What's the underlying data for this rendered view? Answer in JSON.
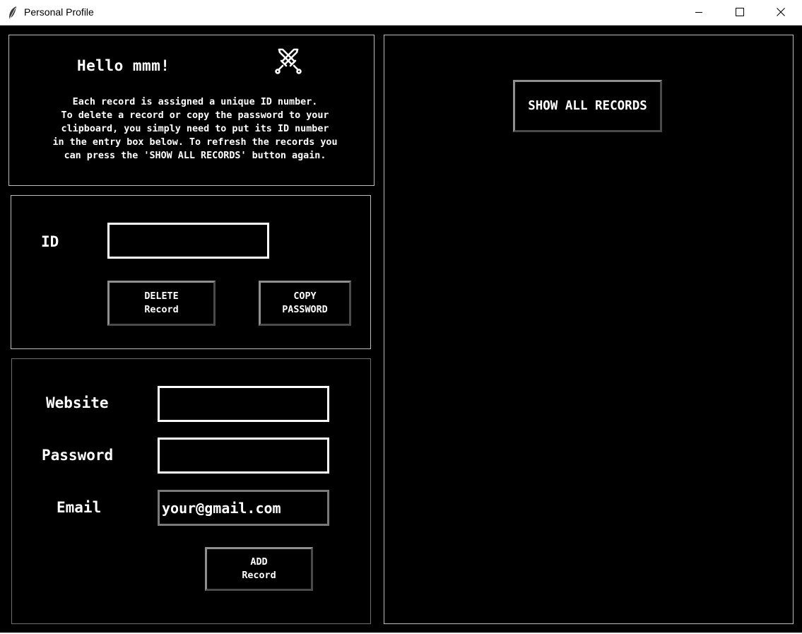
{
  "window": {
    "title": "Personal Profile",
    "icons": {
      "app": "feather-icon",
      "minimize": "minimize-icon",
      "maximize": "maximize-icon",
      "close": "close-icon"
    }
  },
  "info": {
    "greeting": "Hello mmm!",
    "icon": "crossed-swords-icon",
    "instructions": "Each record is assigned a unique ID number.\nTo delete a record or copy the password to your\nclipboard, you simply need to put its ID number\nin the entry box below. To refresh the records you\ncan press the 'SHOW ALL RECORDS' button again."
  },
  "id_panel": {
    "id_label": "ID",
    "id_value": "",
    "delete_button": "DELETE\nRecord",
    "copy_button": "COPY\nPASSWORD"
  },
  "add_panel": {
    "website_label": "Website",
    "website_value": "",
    "password_label": "Password",
    "password_value": "",
    "email_label": "Email",
    "email_value": "your@gmail.com",
    "add_button": "ADD\nRecord"
  },
  "records_panel": {
    "show_all_button": "SHOW ALL RECORDS"
  },
  "colors": {
    "background": "#000000",
    "text": "#ffffff",
    "frame_border": "#bdbdbd",
    "entry_border": "#ffffff"
  }
}
